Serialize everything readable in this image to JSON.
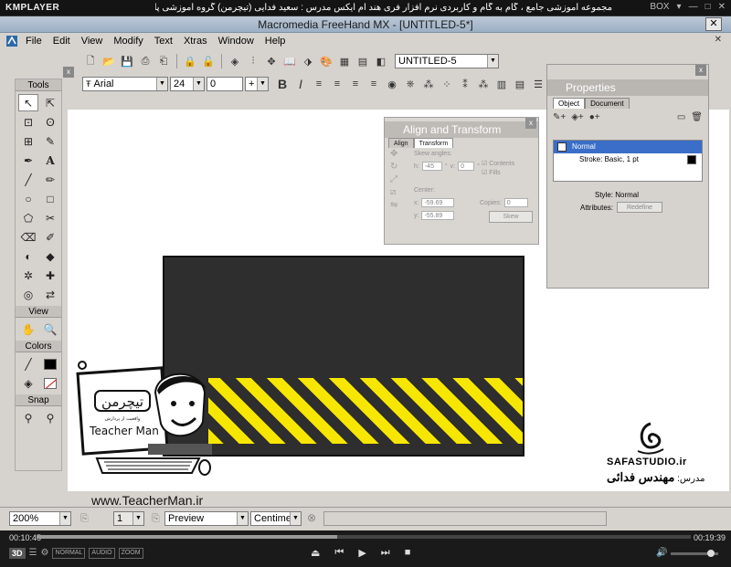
{
  "kmplayer": {
    "logo": "KMPLAYER",
    "title": "مجموعه آموزشی جامع ، گام به گام و کاربردی نرم افزار فری هند ام ایکس  مدرس : سعید فدایی (تیچرمن) گروه آموزشی پادشاه گرافیست ها",
    "box_label": "BOX",
    "time_elapsed": "00:10:45",
    "time_total": "00:19:39",
    "progress_fraction": 0.46,
    "badges": [
      "3D",
      "NORMAL",
      "AUDIO",
      "ZOOM"
    ]
  },
  "freehand": {
    "title": "Macromedia FreeHand MX - [UNTITLED-5*]",
    "menus": [
      "File",
      "Edit",
      "View",
      "Modify",
      "Text",
      "Xtras",
      "Window",
      "Help"
    ],
    "document_select": "UNTITLED-5",
    "font_name": "Arial",
    "font_size": "24",
    "leading": "0",
    "leading_mode": "+",
    "bold_label": "B",
    "italic_label": "I"
  },
  "tools": {
    "header": "Tools",
    "view_header": "View",
    "colors_header": "Colors",
    "snap_header": "Snap",
    "close": "x"
  },
  "properties": {
    "title": "Properties",
    "tabs": [
      "Object",
      "Document"
    ],
    "rows": [
      "Normal",
      "Stroke: Basic, 1 pt"
    ],
    "style_label": "Style: Normal",
    "attributes_label": "Attributes:",
    "redefine_label": "Redefine",
    "close": "x"
  },
  "align": {
    "title": "Align and Transform",
    "tabs": [
      "Align",
      "Transform"
    ],
    "skew_label": "Skew angles:",
    "h_label": "h:",
    "h_value": "-45",
    "v_label": "v:",
    "v_value": "0",
    "contents_label": "Contents",
    "fills_label": "Fills",
    "center_label": "Center:",
    "x_label": "x:",
    "x_value": "-59.69",
    "y_label": "y:",
    "y_value": "-55.89",
    "copies_label": "Copies:",
    "copies_value": "0",
    "skew_button": "Skew",
    "close": "x"
  },
  "statusbar": {
    "zoom": "200%",
    "page": "1",
    "view_mode": "Preview",
    "units": "Centimeters"
  },
  "watermark": {
    "teacher_logo_fa": "تیچرمن",
    "teacher_logo_sub": "واقعیت از پردازش",
    "teacher_logo_en": "Teacher Man",
    "url": "www.TeacherMan.ir",
    "safa": "SAFASTUDIO.ir",
    "teacher_credit_label": "مدرس:",
    "teacher_credit_name": "مهندس فدائی"
  },
  "colors": {
    "stripe_yellow": "#f7e600",
    "artwork_dark": "#2e2e2e",
    "selection_blue": "#3a6ec8"
  }
}
